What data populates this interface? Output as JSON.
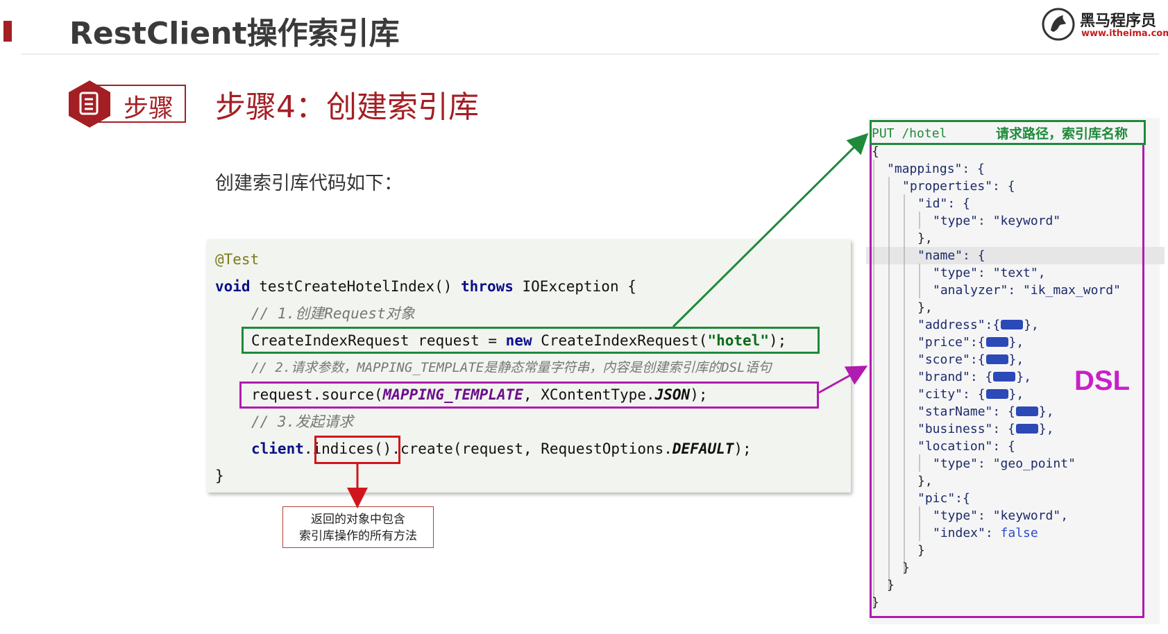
{
  "header": {
    "title": "RestClient操作索引库",
    "logo_text": "黑马程序员",
    "logo_url": "www.itheima.com"
  },
  "step": {
    "badge_label": "步骤",
    "heading": "步骤4：创建索引库",
    "intro": "创建索引库代码如下："
  },
  "code": {
    "annotation": "@Test",
    "kw_void": "void",
    "method": " testCreateHotelIndex() ",
    "kw_throws": "throws",
    "exception": " IOException {",
    "comment1": "// 1.创建Request对象",
    "line4_a": "CreateIndexRequest request = ",
    "kw_new": "new",
    "line4_b": " CreateIndexRequest(",
    "line4_str": "\"hotel\"",
    "line4_c": ");",
    "comment2": "// 2.请求参数，MAPPING_TEMPLATE是静态常量字符串，内容是创建索引库的DSL语句",
    "line6_a": "request.source(",
    "line6_const": "MAPPING_TEMPLATE",
    "line6_b": ", XContentType.",
    "line6_json": "JSON",
    "line6_c": ");",
    "comment3": "// 3.发起请求",
    "kw_client": "client",
    "line8_a": ".",
    "line8_indices": "indices()",
    "line8_b": ".create(request, RequestOptions.",
    "line8_default": "DEFAULT",
    "line8_c": ");",
    "closing": "}"
  },
  "tip": {
    "line1": "返回的对象中包含",
    "line2": "索引库操作的所有方法"
  },
  "dsl": {
    "request_line": "PUT /hotel",
    "request_label": "请求路径，索引库名称",
    "label": "DSL",
    "open_brace": "{",
    "mappings": "\"mappings\": {",
    "properties": "\"properties\": {",
    "id": "\"id\": {",
    "id_type": "\"type\": \"keyword\"",
    "close1": "},",
    "name": "\"name\": {",
    "name_type": "\"type\": \"text\",",
    "name_analyzer": "\"analyzer\": \"ik_max_word\"",
    "close2": "},",
    "address": "\"address\":{",
    "price": "\"price\":{",
    "score": "\"score\":{",
    "brand": "\"brand\": {",
    "city": "\"city\": {",
    "starName": "\"starName\": {",
    "business": "\"business\": {",
    "chip_close": "},",
    "location": "\"location\": {",
    "location_type": "\"type\": \"geo_point\"",
    "close3": "},",
    "pic": "\"pic\":{",
    "pic_type": "\"type\": \"keyword\",",
    "pic_index_key": "\"index\": ",
    "pic_index_val": "false",
    "close4": "}",
    "close5": "}",
    "close6": "}",
    "close7": "}"
  },
  "colors": {
    "brand_red": "#a31f24",
    "highlight_green": "#1e8a3a",
    "highlight_purple": "#b01bb0",
    "highlight_red": "#d0161c"
  }
}
